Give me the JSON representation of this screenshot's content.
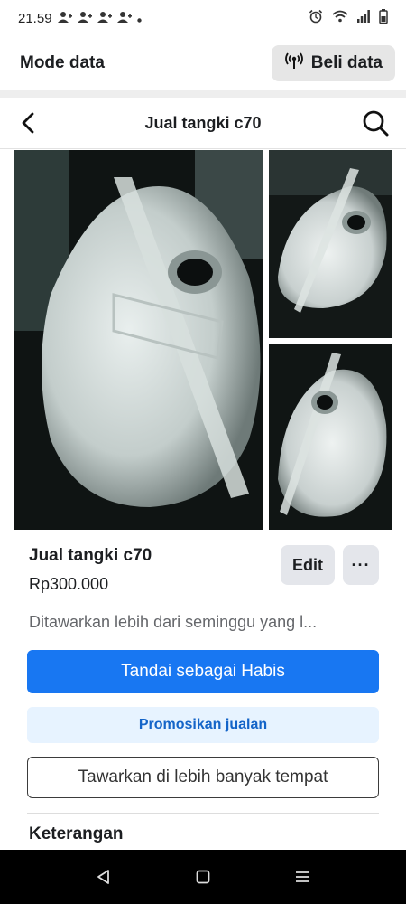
{
  "status_bar": {
    "time": "21.59"
  },
  "data_bar": {
    "title": "Mode data",
    "buy_label": "Beli data"
  },
  "header": {
    "title": "Jual tangki c70"
  },
  "listing": {
    "title": "Jual tangki c70",
    "price": "Rp300.000",
    "listed_text": "Ditawarkan lebih dari seminggu yang l...",
    "edit_label": "Edit",
    "more_label": "···"
  },
  "actions": {
    "mark_sold": "Tandai sebagai Habis",
    "promote": "Promosikan jualan",
    "list_more": "Tawarkan di lebih banyak tempat"
  },
  "description": {
    "heading": "Keterangan"
  },
  "colors": {
    "primary": "#1877f2",
    "promote_bg": "#e7f3ff",
    "promote_text": "#1464c8"
  }
}
